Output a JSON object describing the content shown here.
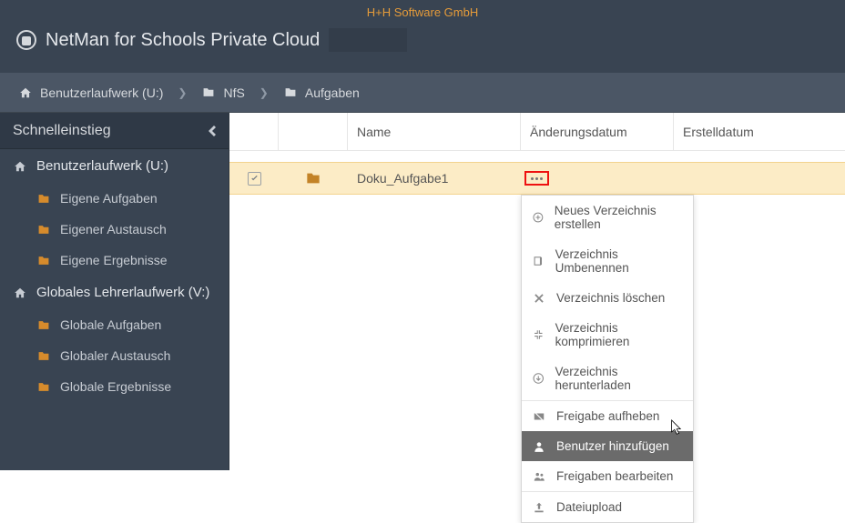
{
  "company": "H+H Software GmbH",
  "app_title": "NetMan for Schools Private Cloud",
  "breadcrumb": [
    {
      "icon": "home",
      "label": "Benutzerlaufwerk (U:)"
    },
    {
      "icon": "folder",
      "label": "NfS"
    },
    {
      "icon": "folder",
      "label": "Aufgaben"
    }
  ],
  "sidebar": {
    "header": "Schnelleinstieg",
    "groups": [
      {
        "icon": "home",
        "label": "Benutzerlaufwerk (U:)",
        "items": [
          "Eigene Aufgaben",
          "Eigener Austausch",
          "Eigene Ergebnisse"
        ]
      },
      {
        "icon": "home",
        "label": "Globales Lehrerlaufwerk (V:)",
        "items": [
          "Globale Aufgaben",
          "Globaler Austausch",
          "Globale Ergebnisse"
        ]
      }
    ]
  },
  "columns": {
    "name": "Name",
    "modified": "Änderungsdatum",
    "created": "Erstelldatum"
  },
  "rows": [
    {
      "name": "Doku_Aufgabe1",
      "selected": true
    }
  ],
  "context_menu": {
    "groups": [
      [
        "Neues Verzeichnis erstellen",
        "Verzeichnis Umbenennen",
        "Verzeichnis löschen",
        "Verzeichnis komprimieren",
        "Verzeichnis herunterladen"
      ],
      [
        "Freigabe aufheben",
        "Benutzer hinzufügen",
        "Freigaben bearbeiten"
      ],
      [
        "Dateiupload"
      ]
    ],
    "active": "Benutzer hinzufügen",
    "icons": {
      "Neues Verzeichnis erstellen": "plus-circle",
      "Verzeichnis Umbenennen": "rename",
      "Verzeichnis löschen": "x",
      "Verzeichnis komprimieren": "compress",
      "Verzeichnis herunterladen": "download-circle",
      "Freigabe aufheben": "unshare",
      "Benutzer hinzufügen": "user",
      "Freigaben bearbeiten": "users",
      "Dateiupload": "upload"
    }
  }
}
